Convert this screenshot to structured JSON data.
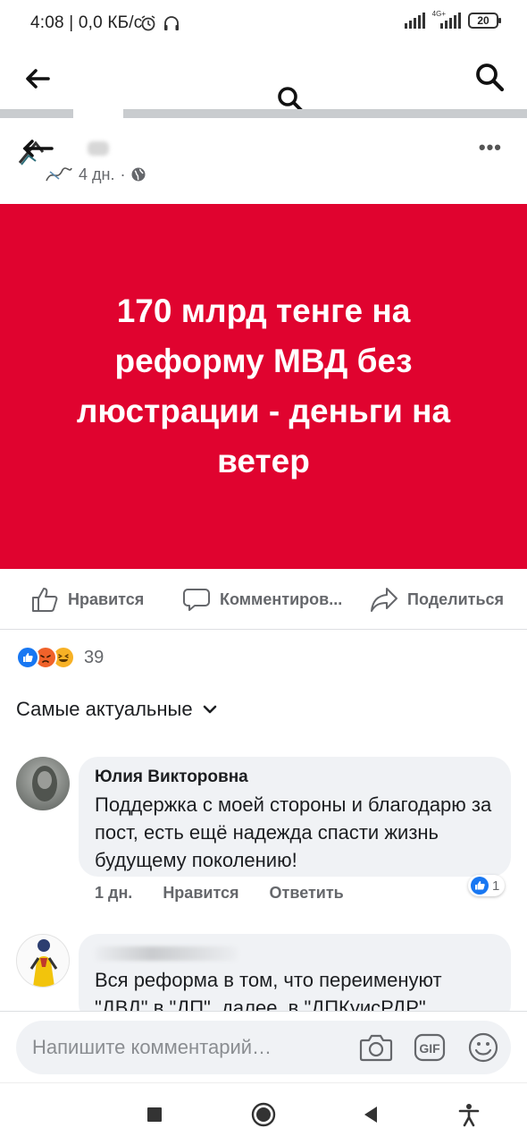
{
  "status_bar": {
    "time_and_speed": "4:08 | 0,0 КБ/с",
    "network_label": "4G+",
    "battery": "20"
  },
  "post": {
    "time": "4 дн.",
    "separator": "·",
    "more": "•••",
    "image_text": "170 млрд тенге на реформу МВД без люстрации - деньги на ветер"
  },
  "actions": {
    "like": "Нравится",
    "comment": "Комментиров...",
    "share": "Поделиться"
  },
  "reactions": {
    "count": "39",
    "colors": {
      "like": "#1877f2",
      "angry": "#f0622a",
      "haha": "#f7b125"
    }
  },
  "sort": {
    "label": "Самые актуальные"
  },
  "comments": [
    {
      "author": "Юлия Викторовна",
      "text": "Поддержка с моей стороны и благодарю за пост, есть ещё надежда спасти жизнь будущему поколению!",
      "time": "1 дн.",
      "like_action": "Нравится",
      "reply_action": "Ответить",
      "likes": "1"
    },
    {
      "text_line1": "Вся реформа в том, что переименуют",
      "text_line2": "\"ДВД\" в \"ДП\", далее, в \"ДПКуисРДР\""
    }
  ],
  "composer": {
    "placeholder": "Напишите комментарий…",
    "gif": "GIF"
  },
  "colors": {
    "brand_red": "#e0032f",
    "accent_blue": "#1877f2"
  }
}
